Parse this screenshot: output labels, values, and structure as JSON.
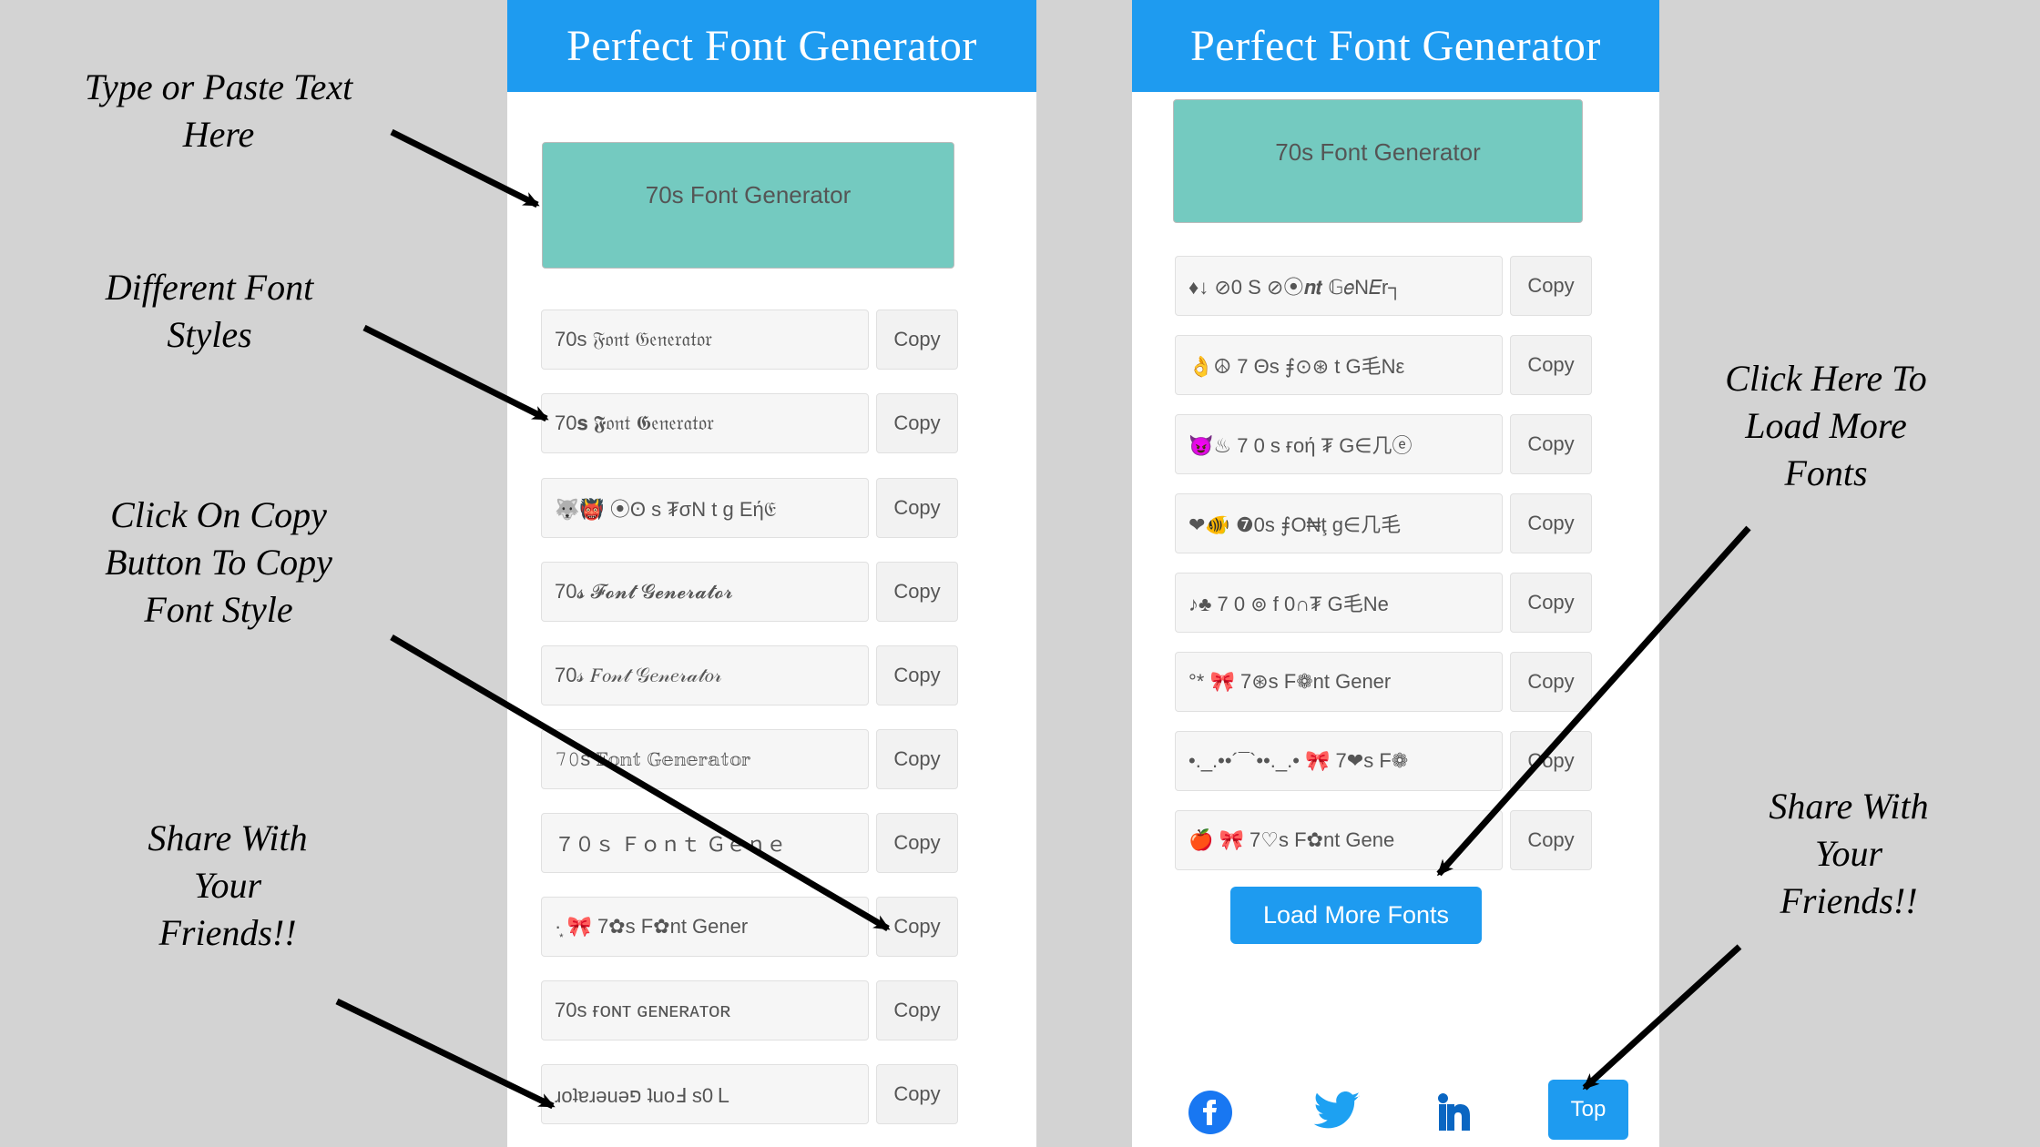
{
  "banner": "Perfect Font Generator",
  "input_text": "70s Font Generator",
  "copy_label": "Copy",
  "load_more": "Load More Fonts",
  "top_label": "Top",
  "left_rows": [
    "70s 𝔉𝔬𝔫𝔱 𝔊𝔢𝔫𝔢𝔯𝔞𝔱𝔬𝔯",
    "70𝐬 𝕱𝔬𝔫𝔱 𝕲𝔢𝔫𝔢𝔯𝔞𝔱𝔬𝔯",
    "🐺👹 ⦿ʘ s  ₮σN t  g Eή𝔈",
    "70𝓼 𝓕𝓸𝓷𝓽 𝓖𝓮𝓷𝓮𝓻𝓪𝓽𝓸𝓻",
    "70𝓈 𝐹𝑜𝓃𝓉 𝒢𝑒𝓃𝑒𝓇𝒶𝓉𝑜𝓇",
    "𝟽𝟶s 𝔽𝕠𝕟𝕥 𝔾𝕖𝕟𝕖𝕣𝕒𝕥𝕠𝕣",
    "７０ｓ Ｆｏｎｔ Ｇｅｎｅ",
    "·͙ 🎀 7✿s F✿nt Gener",
    "70s ғᴏɴᴛ ɢᴇɴᴇʀᴀᴛᴏʀ",
    "ɹoʇɐɹǝuǝפ ʇuoℲ s0Ｌ"
  ],
  "right_rows": [
    "♦↓ ⊘0 S  ⊘⦿𝒏𝒕  𝔾𝑒N𝐸r┐",
    "👌☮  7 Θs ⨎⊙⊛ t  G毛Nε",
    "😈♨  7 0 s ғoή ₮  G∈几ⓔ",
    "❤🐠 ❼0s ⨎O₦ţ g∈几毛",
    "♪♣  7 0 ⊚  f 0∩₮ G毛Ne",
    "°*  🎀  7⊛s F❁nt Gener",
    "•._.••´¯`••._.•  🎀  7❤s F❁",
    "🍎 🎀  7♡s F✿nt Gene"
  ],
  "annotations": {
    "a1": "Type or Paste Text\nHere",
    "a2": "Different Font\nStyles",
    "a3": "Click On Copy\nButton To Copy\nFont Style",
    "a4": "Share With\nYour\nFriends!!",
    "a5": "Click Here To\nLoad More\nFonts",
    "a6": "Share With\nYour\nFriends!!"
  }
}
